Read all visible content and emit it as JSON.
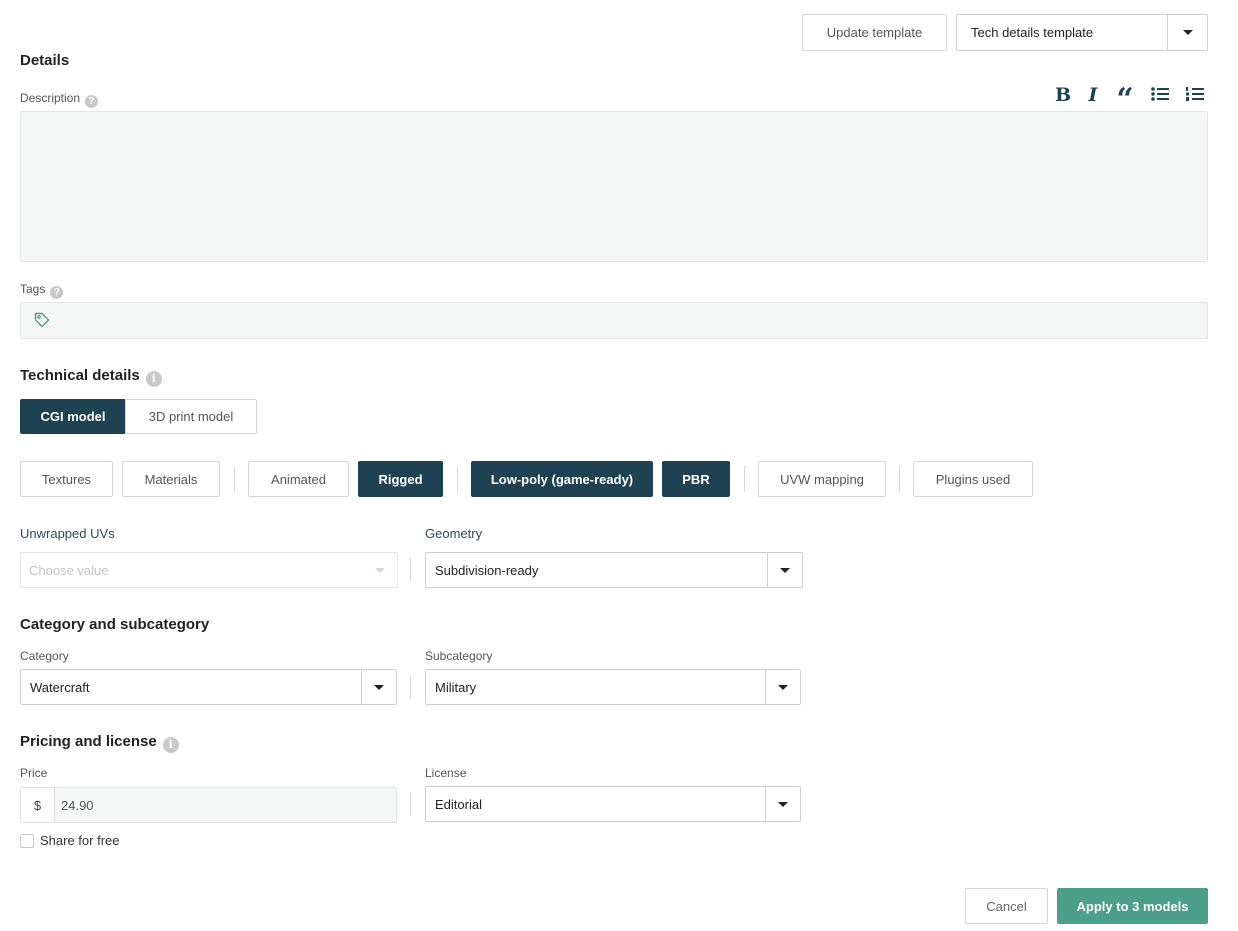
{
  "top_bar": {
    "update_template_label": "Update template",
    "template_select_value": "Tech details template"
  },
  "details": {
    "title": "Details",
    "description_label": "Description",
    "tags_label": "Tags"
  },
  "editor_toolbar": {
    "bold": "B",
    "italic": "I",
    "quote": "“",
    "icons": [
      "bold-icon",
      "italic-icon",
      "quote-icon",
      "bullet-list-icon",
      "numbered-list-icon"
    ]
  },
  "technical": {
    "title": "Technical details",
    "model_types": [
      {
        "label": "CGI model",
        "active": true
      },
      {
        "label": "3D print model",
        "active": false
      }
    ],
    "features": [
      {
        "label": "Textures",
        "active": false
      },
      {
        "label": "Materials",
        "active": false
      },
      {
        "label": "Animated",
        "active": false
      },
      {
        "label": "Rigged",
        "active": true
      },
      {
        "label": "Low-poly (game-ready)",
        "active": true
      },
      {
        "label": "PBR",
        "active": true
      },
      {
        "label": "UVW mapping",
        "active": false
      },
      {
        "label": "Plugins used",
        "active": false
      }
    ],
    "unwrapped_uvs_label": "Unwrapped UVs",
    "unwrapped_uvs_placeholder": "Choose value",
    "geometry_label": "Geometry",
    "geometry_value": "Subdivision-ready"
  },
  "category": {
    "title": "Category and subcategory",
    "category_label": "Category",
    "category_value": "Watercraft",
    "subcategory_label": "Subcategory",
    "subcategory_value": "Military"
  },
  "pricing": {
    "title": "Pricing and license",
    "price_label": "Price",
    "currency": "$",
    "price_value": "24.90",
    "license_label": "License",
    "license_value": "Editorial",
    "share_free_label": "Share for free",
    "share_free_checked": false
  },
  "footer": {
    "cancel_label": "Cancel",
    "apply_label": "Apply to 3 models"
  },
  "colors": {
    "dark_accent": "#1e4252",
    "green_accent": "#4c9f88"
  }
}
